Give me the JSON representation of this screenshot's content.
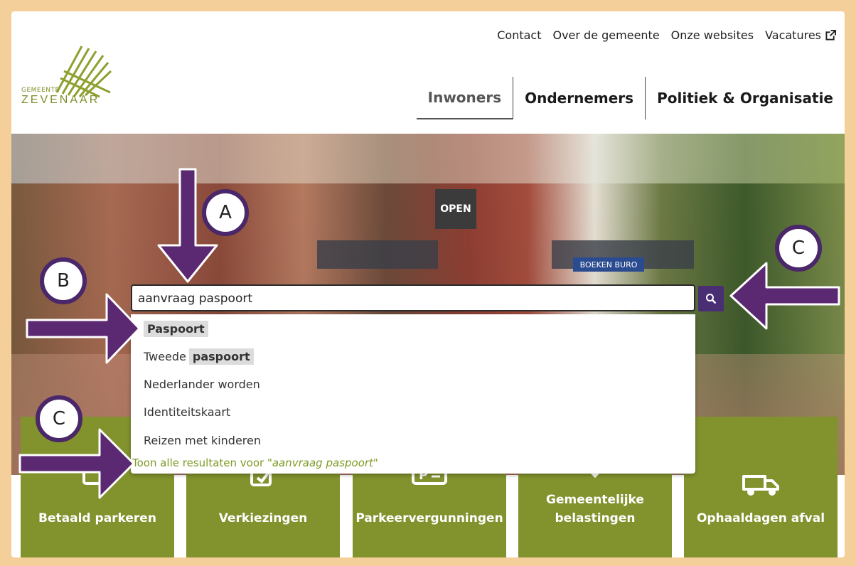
{
  "logo": {
    "small": "GEMEENTE",
    "big": "ZEVENAAR"
  },
  "topnav": [
    "Contact",
    "Over de gemeente",
    "Onze websites",
    "Vacatures"
  ],
  "mainnav": [
    "Inwoners",
    "Ondernemers",
    "Politiek & Organisatie"
  ],
  "search": {
    "value": "aanvraag paspoort"
  },
  "suggestions": {
    "s1": "Paspoort",
    "s2a": "Tweede",
    "s2b": "paspoort",
    "s3": "Nederlander worden",
    "s4": "Identiteitskaart",
    "s5": "Reizen met kinderen",
    "all_prefix": "Toon alle resultaten voor \"",
    "all_query": "aanvraag paspoort",
    "all_suffix": "\""
  },
  "hero_signs": {
    "open": "OPEN",
    "shop": "BOEKEN BURO"
  },
  "tiles": [
    "Betaald parkeren",
    "Verkiezingen",
    "Parkeervergunningen",
    "Gemeentelijke belastingen",
    "Ophaaldagen afval"
  ],
  "annotations": {
    "a": "A",
    "b": "B",
    "c1": "C",
    "c2": "C"
  },
  "colors": {
    "brand_green": "#82922d",
    "accent_purple": "#4a2768",
    "frame": "#f5cf9a"
  }
}
